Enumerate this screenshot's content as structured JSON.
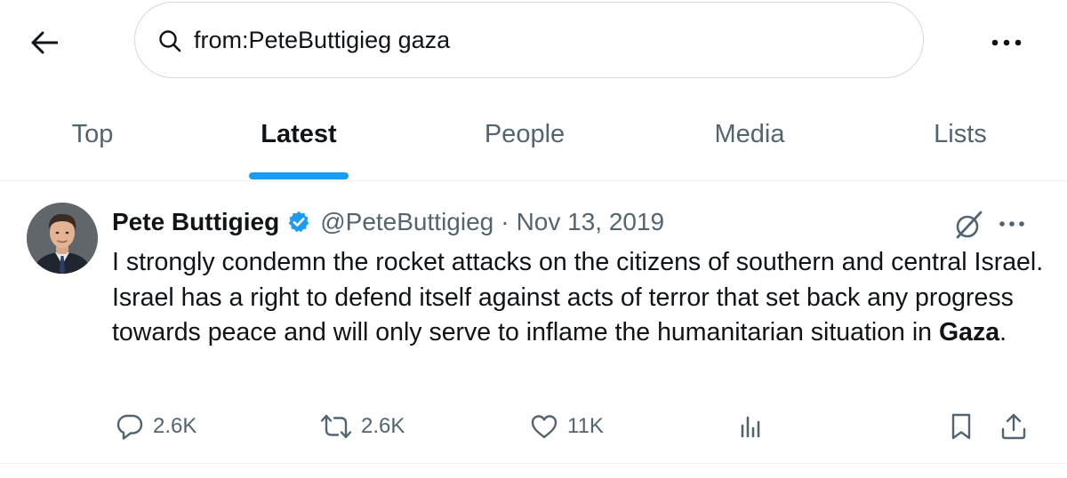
{
  "search": {
    "query": "from:PeteButtigieg gaza"
  },
  "tabs": [
    {
      "label": "Top",
      "active": false
    },
    {
      "label": "Latest",
      "active": true
    },
    {
      "label": "People",
      "active": false
    },
    {
      "label": "Media",
      "active": false
    },
    {
      "label": "Lists",
      "active": false
    }
  ],
  "tweet": {
    "display_name": "Pete Buttigieg",
    "handle": "@PeteButtigieg",
    "separator": "·",
    "date": "Nov 13, 2019",
    "text_main": "I strongly condemn the rocket attacks on the citizens of southern and central Israel. Israel has a right to defend itself against acts of terror that set back any progress towards peace and will only serve to inflame the humanitarian situation in ",
    "text_highlight": "Gaza",
    "text_end": ".",
    "replies": "2.6K",
    "reposts": "2.6K",
    "likes": "11K"
  },
  "icons": {
    "back": "arrow-left-icon",
    "search": "search-icon",
    "more": "more-horizontal-icon",
    "verified": "verified-badge-icon",
    "grok": "grok-icon",
    "reply": "reply-icon",
    "repost": "repost-icon",
    "like": "heart-icon",
    "views": "analytics-icon",
    "bookmark": "bookmark-icon",
    "share": "share-icon"
  },
  "colors": {
    "accent": "#1d9bf0",
    "text_primary": "#0f1419",
    "text_secondary": "#536471",
    "border": "#cfd9de"
  }
}
